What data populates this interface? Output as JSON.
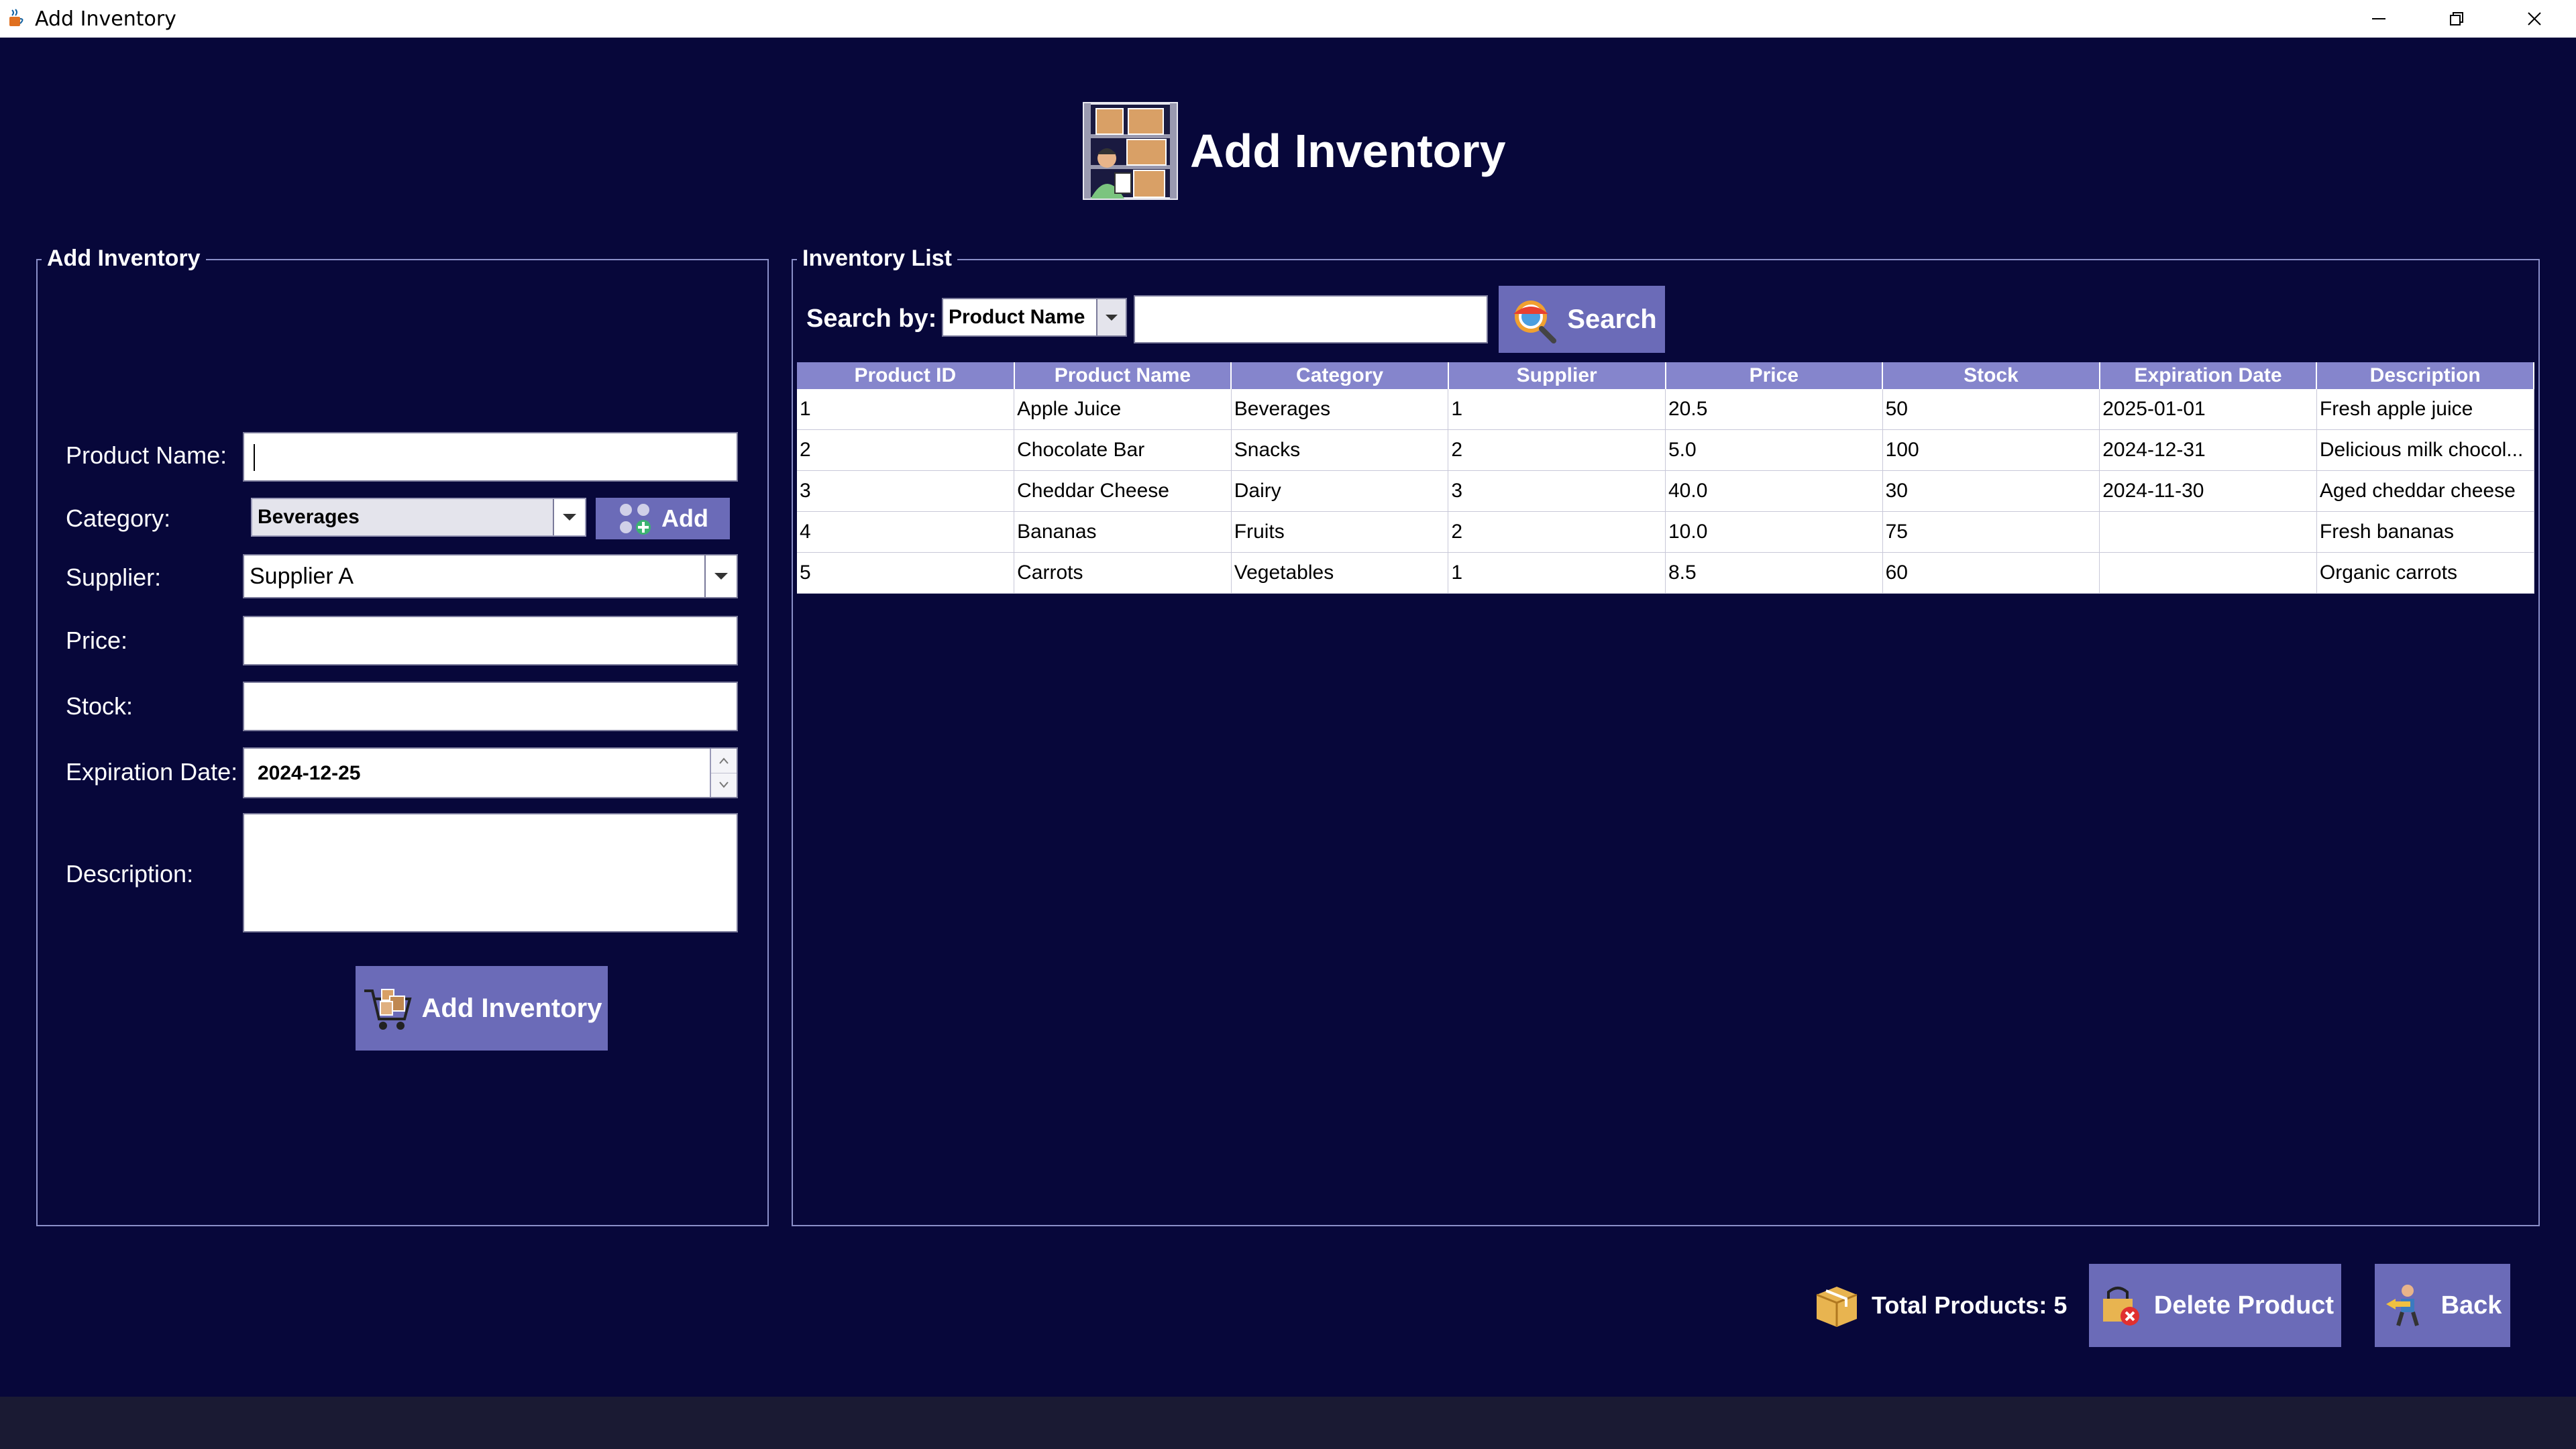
{
  "window": {
    "title": "Add Inventory"
  },
  "header": {
    "title": "Add Inventory"
  },
  "form_panel": {
    "title": "Add Inventory",
    "labels": {
      "product_name": "Product Name:",
      "category": "Category:",
      "supplier": "Supplier:",
      "price": "Price:",
      "stock": "Stock:",
      "expiration_date": "Expiration Date:",
      "description": "Description:"
    },
    "values": {
      "product_name": "",
      "category": "Beverages",
      "supplier": "Supplier A",
      "price": "",
      "stock": "",
      "expiration_date": "2024-12-25",
      "description": ""
    },
    "add_category_label": "Add",
    "submit_label": "Add Inventory"
  },
  "list_panel": {
    "title": "Inventory List",
    "search_by_label": "Search by:",
    "search_by_value": "Product Name",
    "search_query": "",
    "search_label": "Search",
    "columns": [
      "Product ID",
      "Product Name",
      "Category",
      "Supplier",
      "Price",
      "Stock",
      "Expiration Date",
      "Description"
    ],
    "rows": [
      [
        "1",
        "Apple Juice",
        "Beverages",
        "1",
        "20.5",
        "50",
        "2025-01-01",
        "Fresh apple juice"
      ],
      [
        "2",
        "Chocolate Bar",
        "Snacks",
        "2",
        "5.0",
        "100",
        "2024-12-31",
        "Delicious milk chocol..."
      ],
      [
        "3",
        "Cheddar Cheese",
        "Dairy",
        "3",
        "40.0",
        "30",
        "2024-11-30",
        "Aged cheddar cheese"
      ],
      [
        "4",
        "Bananas",
        "Fruits",
        "2",
        "10.0",
        "75",
        "",
        "Fresh bananas"
      ],
      [
        "5",
        "Carrots",
        "Vegetables",
        "1",
        "8.5",
        "60",
        "",
        "Organic carrots"
      ]
    ]
  },
  "footer": {
    "total_label": "Total Products: 5",
    "delete_label": "Delete Product",
    "back_label": "Back"
  },
  "icons": {
    "app": "java-cup-icon",
    "header": "warehouse-worker-icon",
    "add_category": "add-category-icon",
    "search": "magnifier-icon",
    "submit": "shopping-cart-icon",
    "total": "box-icon",
    "delete": "delete-box-icon",
    "back": "person-back-icon"
  },
  "colors": {
    "background": "#07073a",
    "button": "#6b6bb8",
    "table_header": "#8585cc"
  }
}
